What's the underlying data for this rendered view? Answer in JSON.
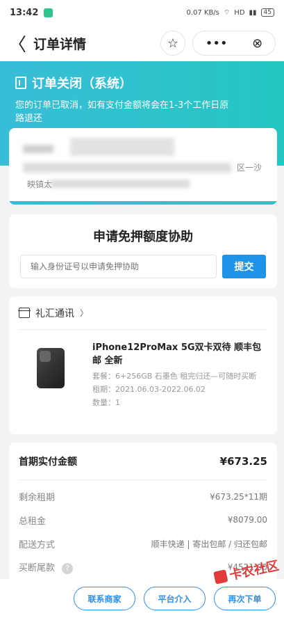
{
  "status": {
    "time": "13:42",
    "signal": "0.07 KB/s",
    "hd": "HD",
    "battery": "45"
  },
  "nav": {
    "back": "〈",
    "title": "订单详情",
    "star": "☆",
    "more": "•••",
    "close": "⊗"
  },
  "hero": {
    "title": "订单关闭（系统）",
    "desc": "您的订单已取消，如有支付金额将会在1-3个工作日原路退还"
  },
  "address": {
    "tail1": "区一沙",
    "tail2": "映镇太"
  },
  "apply": {
    "title": "申请免押额度协助",
    "placeholder": "输入身份证号以申请免押协助",
    "submit": "提交"
  },
  "product": {
    "shop": "礼汇通讯",
    "chevron": "〉",
    "name": "iPhone12ProMax 5G双卡双待 顺丰包邮 全新",
    "package": "套餐：6+256GB 石墨色 租完归还—可随时买断",
    "period": "租期：2021.06.03-2022.06.02",
    "qty": "数量：1"
  },
  "amount": {
    "first_label": "首期实付金额",
    "first_value": "¥673.25",
    "lines": [
      {
        "label": "剩余租期",
        "value": "¥673.25*11期"
      },
      {
        "label": "总租金",
        "value": "¥8079.00"
      },
      {
        "label": "配送方式",
        "value": "顺丰快递 | 寄出包邮 / 归还包邮"
      },
      {
        "label": "买断尾款",
        "value": "¥4521.00"
      }
    ]
  },
  "bottom": {
    "contact": "联系商家",
    "platform": "平台介入",
    "reorder": "再次下单"
  },
  "watermark": "卡农社区",
  "colors": {
    "hero_start": "#38bdd8",
    "hero_end": "#25c7c2",
    "primary": "#1e94e8",
    "outline": "#2d8ff0"
  }
}
